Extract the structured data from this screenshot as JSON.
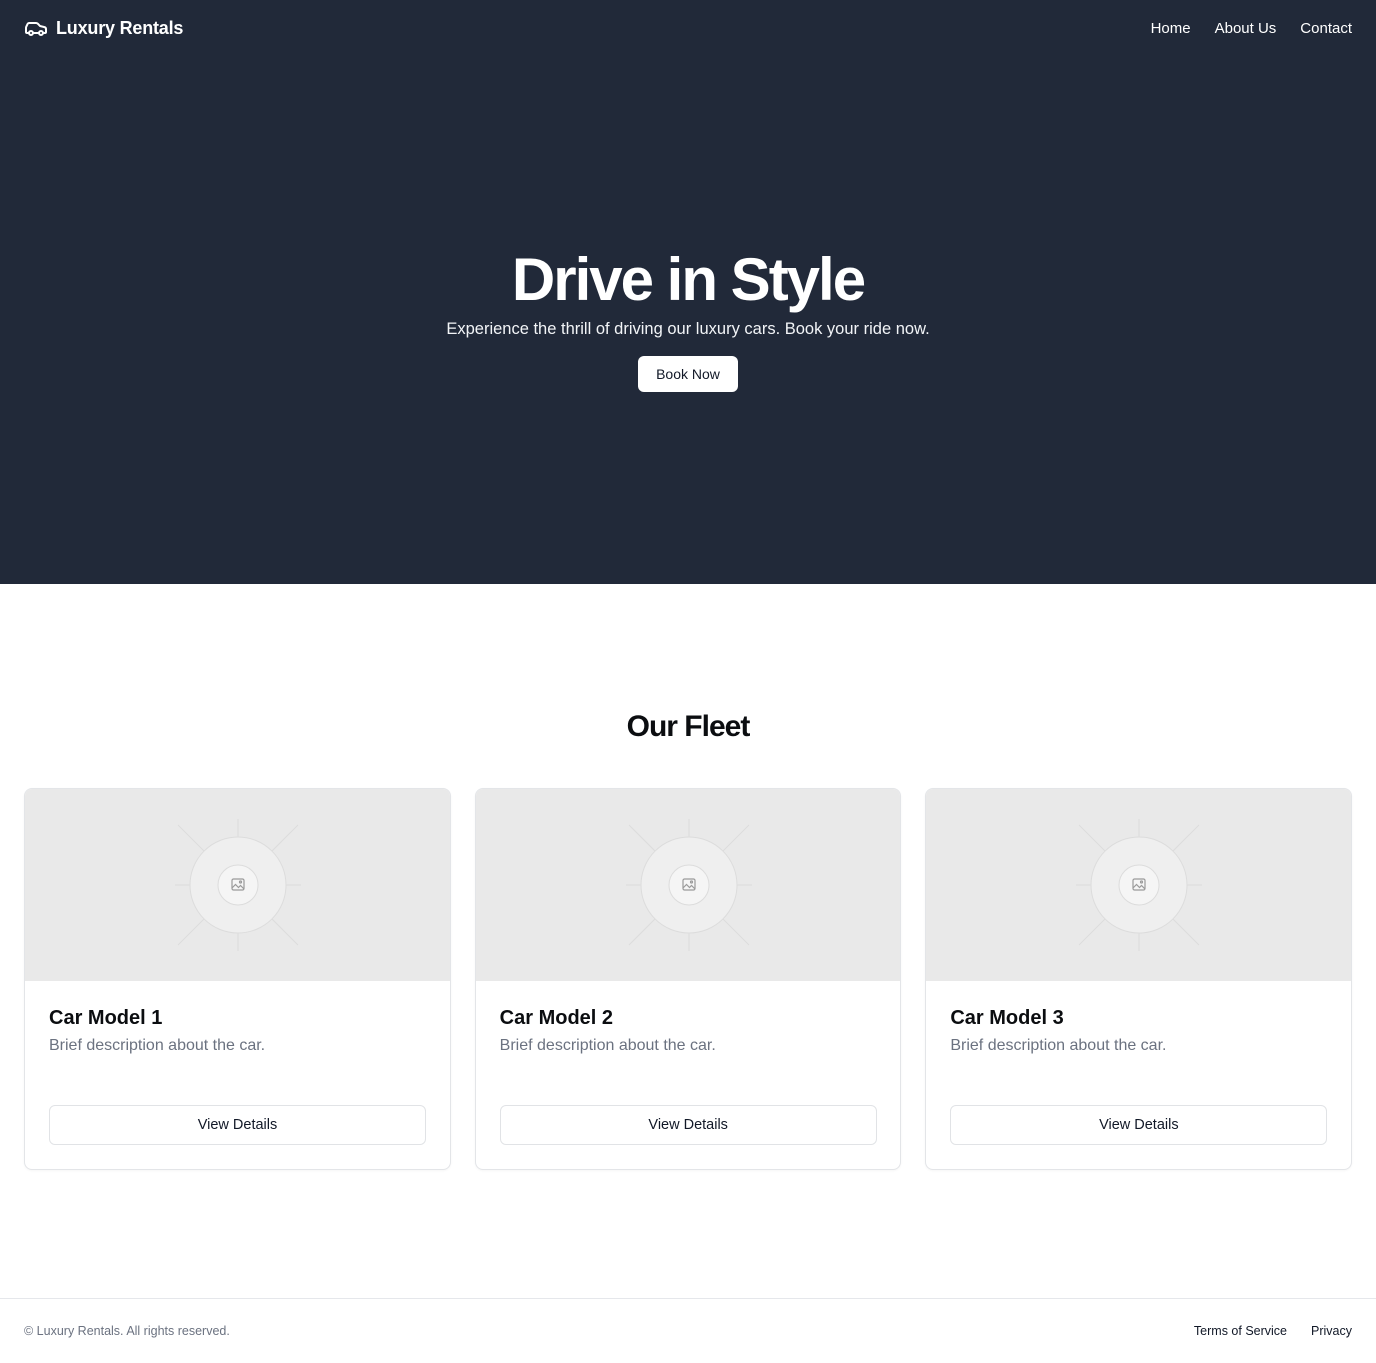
{
  "header": {
    "brand_icon": "car-icon",
    "brand_name": "Luxury Rentals",
    "nav": [
      {
        "label": "Home"
      },
      {
        "label": "About Us"
      },
      {
        "label": "Contact"
      }
    ]
  },
  "hero": {
    "title": "Drive in Style",
    "subtitle": "Experience the thrill of driving our luxury cars. Book your ride now.",
    "cta_label": "Book Now"
  },
  "fleet": {
    "title": "Our Fleet",
    "cards": [
      {
        "image_icon": "image-placeholder-icon",
        "title": "Car Model 1",
        "description": "Brief description about the car.",
        "button_label": "View Details"
      },
      {
        "image_icon": "image-placeholder-icon",
        "title": "Car Model 2",
        "description": "Brief description about the car.",
        "button_label": "View Details"
      },
      {
        "image_icon": "image-placeholder-icon",
        "title": "Car Model 3",
        "description": "Brief description about the car.",
        "button_label": "View Details"
      }
    ]
  },
  "footer": {
    "copyright": "© Luxury Rentals. All rights reserved.",
    "links": [
      {
        "label": "Terms of Service"
      },
      {
        "label": "Privacy"
      }
    ]
  },
  "colors": {
    "header_bg": "#212939",
    "hero_bg": "#212939",
    "page_bg": "#ffffff",
    "placeholder_bg": "#e9e9e9",
    "muted_text": "#6b7280"
  }
}
